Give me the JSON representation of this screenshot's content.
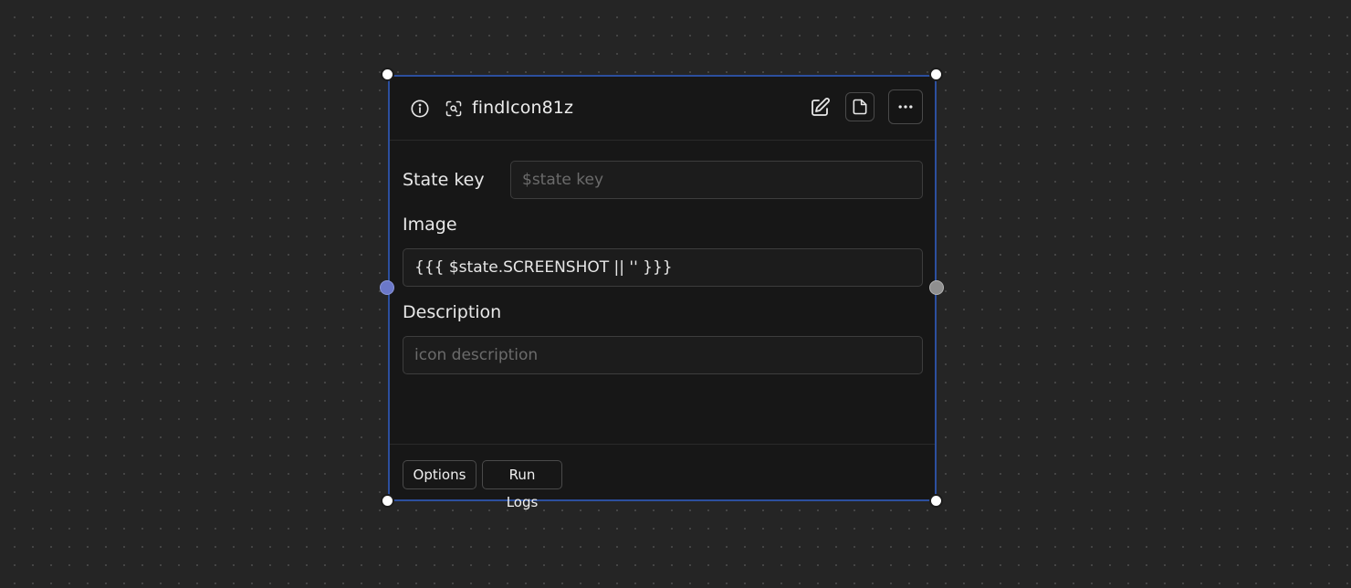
{
  "node": {
    "title": "findIcon81z",
    "header_icons": {
      "info": "info-icon",
      "scan": "scan-eye-icon",
      "edit": "edit-icon",
      "file": "file-icon",
      "more": "more-horizontal-icon"
    },
    "fields": {
      "state_key": {
        "label": "State key",
        "value": "",
        "placeholder": "$state key"
      },
      "image": {
        "label": "Image",
        "value": "{{{ $state.SCREENSHOT || '' }}}",
        "placeholder": ""
      },
      "description": {
        "label": "Description",
        "value": "",
        "placeholder": "icon description"
      }
    },
    "footer": {
      "options_label": "Options",
      "run_logs_label": "Run Logs"
    }
  },
  "colors": {
    "canvas_bg": "#252525",
    "node_bg": "#171717",
    "selection_border": "#2c4f9e",
    "input_port": "#6b78c9",
    "output_port": "#8f8f8f"
  }
}
